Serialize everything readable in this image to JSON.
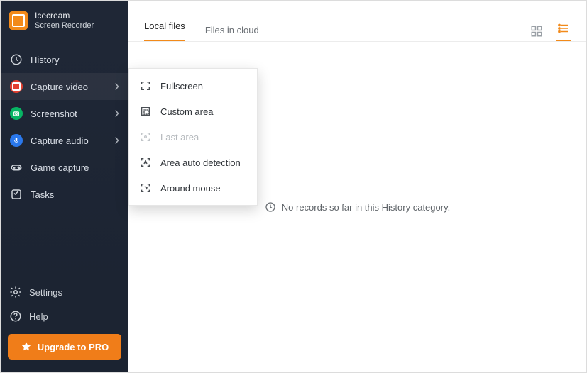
{
  "app": {
    "name": "Icecream",
    "subtitle": "Screen Recorder"
  },
  "sidebar": {
    "items": [
      {
        "label": "History"
      },
      {
        "label": "Capture video"
      },
      {
        "label": "Screenshot"
      },
      {
        "label": "Capture audio"
      },
      {
        "label": "Game capture"
      },
      {
        "label": "Tasks"
      }
    ],
    "bottom": [
      {
        "label": "Settings"
      },
      {
        "label": "Help"
      }
    ],
    "upgrade_label": "Upgrade to PRO"
  },
  "tabs": {
    "local": "Local files",
    "cloud": "Files in cloud"
  },
  "empty_text": "No records so far in this History category.",
  "flyout": {
    "items": [
      {
        "label": "Fullscreen"
      },
      {
        "label": "Custom area"
      },
      {
        "label": "Last area"
      },
      {
        "label": "Area auto detection"
      },
      {
        "label": "Around mouse"
      }
    ]
  },
  "colors": {
    "accent": "#f28a1a"
  }
}
